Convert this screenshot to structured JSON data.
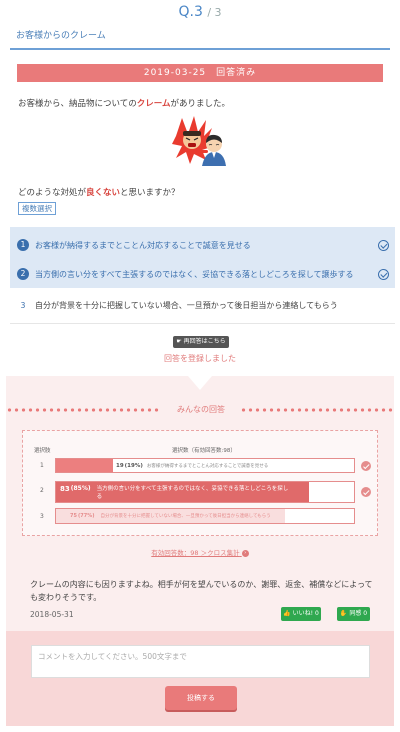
{
  "header": {
    "qnum": "Q.3",
    "qtotal": "/ 3",
    "title": "お客様からのクレーム"
  },
  "date_band": "2019-03-25　回答済み",
  "lead": {
    "before": "お客様から、納品物についての",
    "highlight": "クレーム",
    "after": "がありました。"
  },
  "question": {
    "before": "どのような対処が",
    "highlight": "良くない",
    "after": "と思いますか？"
  },
  "multi_label": "複数選択",
  "choices": [
    {
      "num": "1",
      "text": "お客様が納得するまでとことん対応することで誠意を見せる",
      "selected": true
    },
    {
      "num": "2",
      "text": "当方側の言い分をすべて主張するのではなく、妥協できる落としどころを探して譲歩する",
      "selected": true
    },
    {
      "num": "3",
      "text": "自分が背景を十分に把握していない場合、一旦預かって後日担当から連絡してもらう",
      "selected": false
    }
  ],
  "reanswer_button": "再回答はこちら",
  "registered_text": "回答を登録しました",
  "results": {
    "heading": "みんなの回答",
    "col_choice": "選択肢",
    "col_count": "選択数（有効回答数:98）",
    "rows": [
      {
        "num": "1",
        "count": "19",
        "pct_label": "(19%)",
        "pct": 0.19,
        "text": "お客様が納得するまでとことん対応することで誠意を見せる",
        "mine": true,
        "style": "light"
      },
      {
        "num": "2",
        "count": "83",
        "pct_label": "(85%)",
        "pct": 0.85,
        "text": "当方側の言い分をすべて主張するのではなく、妥協できる落としどころを探し",
        "text2": "る",
        "mine": true,
        "style": "strong"
      },
      {
        "num": "3",
        "count": "75",
        "pct_label": "(77%)",
        "pct": 0.77,
        "text": "自分が背景を十分に把握していない場合、一旦預かって後日担当から連絡してもらう",
        "mine": false,
        "style": "faded"
      }
    ],
    "valid_link": "有効回答数：98 ＞クロス集計"
  },
  "comment": {
    "text": "クレームの内容にも因りますよね。相手が何を望んでいるのか、謝罪、返金、補償などによっても変わりそうです。",
    "date": "2018-05-31",
    "like_label": "いいね! 0",
    "agree_label": "同感 0"
  },
  "form": {
    "placeholder": "コメントを入力してください。500文字まで",
    "submit_label": "投稿する"
  },
  "colors": {
    "accent_blue": "#3a6fad",
    "accent_red": "#e97a7a",
    "green": "#2fa84f",
    "pink_bg": "#fbeeee"
  }
}
